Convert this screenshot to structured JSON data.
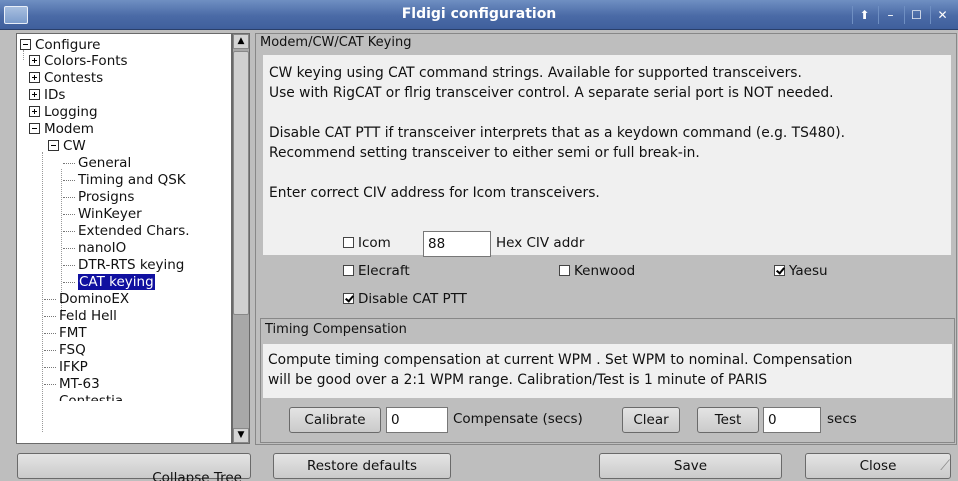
{
  "window": {
    "title": "Fldigi configuration",
    "controls": [
      "⬆",
      "–",
      "☐",
      "✕"
    ]
  },
  "tree": {
    "items": [
      {
        "label": "Configure",
        "level": 0,
        "expander": "minus"
      },
      {
        "label": "Colors-Fonts",
        "level": 1,
        "expander": "plus"
      },
      {
        "label": "Contests",
        "level": 1,
        "expander": "plus"
      },
      {
        "label": "IDs",
        "level": 1,
        "expander": "plus"
      },
      {
        "label": "Logging",
        "level": 1,
        "expander": "plus"
      },
      {
        "label": "Modem",
        "level": 1,
        "expander": "minus"
      },
      {
        "label": "CW",
        "level": 2,
        "expander": "minus"
      },
      {
        "label": "General",
        "level": 3
      },
      {
        "label": "Timing and QSK",
        "level": 3
      },
      {
        "label": "Prosigns",
        "level": 3
      },
      {
        "label": "WinKeyer",
        "level": 3
      },
      {
        "label": "Extended Chars.",
        "level": 3
      },
      {
        "label": "nanoIO",
        "level": 3
      },
      {
        "label": "DTR-RTS keying",
        "level": 3
      },
      {
        "label": "CAT keying",
        "level": 3,
        "selected": true
      },
      {
        "label": "DominoEX",
        "level": 2
      },
      {
        "label": "Feld Hell",
        "level": 2
      },
      {
        "label": "FMT",
        "level": 2
      },
      {
        "label": "FSQ",
        "level": 2
      },
      {
        "label": "IFKP",
        "level": 2
      },
      {
        "label": "MT-63",
        "level": 2
      },
      {
        "label": "Contestia",
        "level": 2
      }
    ]
  },
  "panel": {
    "title": "Modem/CW/CAT Keying",
    "info_lines": [
      "CW keying using CAT command strings.  Available for supported transceivers.",
      "Use with RigCAT or flrig transceiver control.  A separate serial port is NOT needed.",
      "",
      "Disable CAT PTT if transceiver interprets that as a keydown command (e.g. TS480).",
      "Recommend setting transceiver to either semi or full break-in.",
      "",
      "Enter correct CIV address for Icom transceivers."
    ],
    "icom": {
      "label": "Icom",
      "checked": false,
      "civ_value": "88",
      "civ_label": "Hex CIV addr"
    },
    "elecraft": {
      "label": "Elecraft",
      "checked": false
    },
    "kenwood": {
      "label": "Kenwood",
      "checked": false
    },
    "yaesu": {
      "label": "Yaesu",
      "checked": true
    },
    "disable_ptt": {
      "label": "Disable CAT PTT",
      "checked": true
    }
  },
  "timing": {
    "title": "Timing Compensation",
    "info_lines": [
      "Compute timing compensation at current WPM .  Set WPM to nominal.  Compensation",
      "will be good over a 2:1 WPM range.  Calibration/Test is 1 minute of PARIS"
    ],
    "calibrate_label": "Calibrate",
    "compensate_value": "0",
    "compensate_label": "Compensate (secs)",
    "clear_label": "Clear",
    "test_label": "Test",
    "secs_value": "0",
    "secs_label": "secs"
  },
  "buttons": {
    "collapse_tree": "Collapse Tree",
    "restore_defaults": "Restore defaults",
    "save": "Save",
    "close": "Close"
  }
}
